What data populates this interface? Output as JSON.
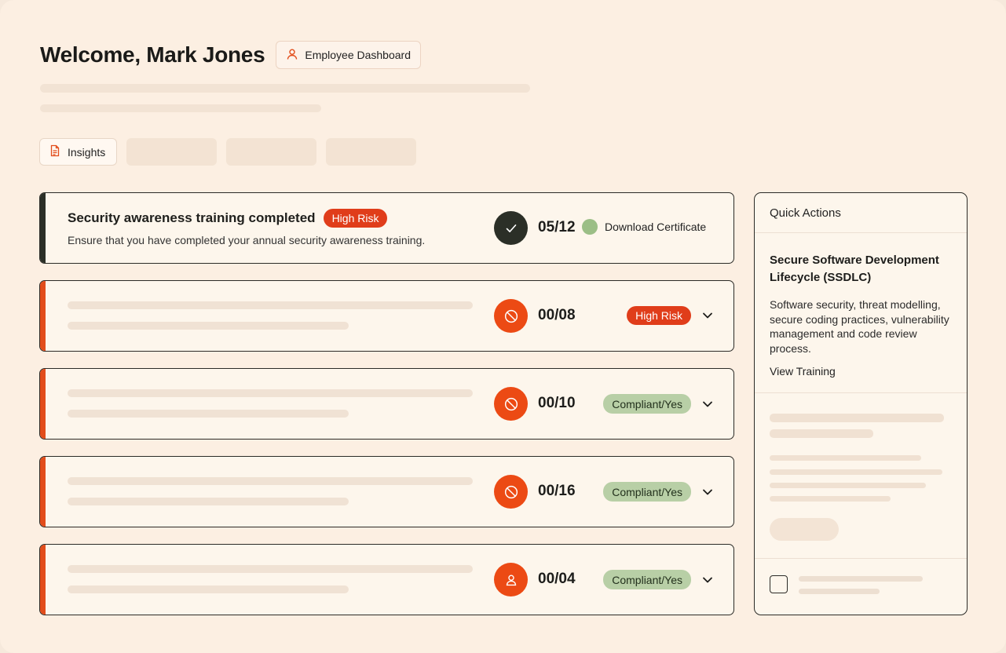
{
  "header": {
    "welcome": "Welcome, Mark Jones",
    "role_chip": "Employee Dashboard",
    "role_icon": "user-icon"
  },
  "tabs": {
    "insights_label": "Insights",
    "insights_icon": "document-icon"
  },
  "colors": {
    "accent": "#e24d1b",
    "risk_badge": "#e03d1a",
    "compliant_badge": "#b8cfa6",
    "done_dark": "#2b2f27"
  },
  "trainings": [
    {
      "title": "Security awareness training completed",
      "badge": "High Risk",
      "description": "Ensure that you have completed your annual security awareness training.",
      "count": "05/12",
      "status_icon": "check-icon",
      "action": "Download Certificate"
    },
    {
      "count": "00/08",
      "status_icon": "blocked-icon",
      "badge": "High Risk"
    },
    {
      "count": "00/10",
      "status_icon": "blocked-icon",
      "badge": "Compliant/Yes"
    },
    {
      "count": "00/16",
      "status_icon": "blocked-icon",
      "badge": "Compliant/Yes"
    },
    {
      "count": "00/04",
      "status_icon": "user-icon",
      "badge": "Compliant/Yes"
    }
  ],
  "quick_actions": {
    "title": "Quick Actions",
    "course_title": "Secure Software Development Lifecycle (SSDLC)",
    "course_description": "Software security, threat modelling, secure coding practices, vulnerability management and code review process.",
    "link": "View Training"
  }
}
